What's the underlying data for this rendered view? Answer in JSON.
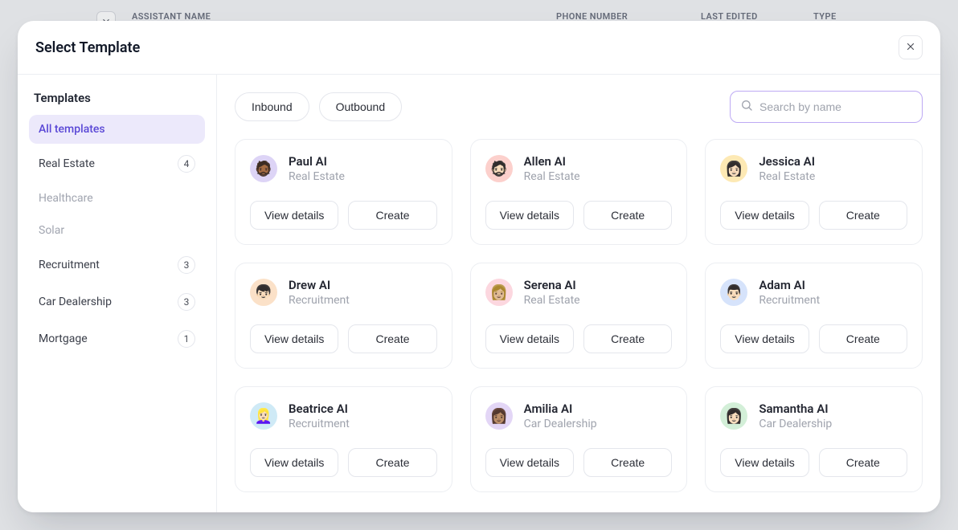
{
  "background": {
    "columns": {
      "assistant": "ASSISTANT NAME",
      "phone": "PHONE NUMBER",
      "edited": "LAST EDITED",
      "type": "TYPE"
    }
  },
  "modal": {
    "title": "Select Template",
    "sidebar": {
      "title": "Templates",
      "items": [
        {
          "label": "All templates",
          "active": true
        },
        {
          "label": "Real Estate",
          "count": "4"
        },
        {
          "label": "Healthcare",
          "muted": true
        },
        {
          "label": "Solar",
          "muted": true
        },
        {
          "label": "Recruitment",
          "count": "3"
        },
        {
          "label": "Car Dealership",
          "count": "3"
        },
        {
          "label": "Mortgage",
          "count": "1"
        }
      ]
    },
    "toolbar": {
      "filters": [
        "Inbound",
        "Outbound"
      ],
      "search_placeholder": "Search by name"
    },
    "card_buttons": {
      "details": "View details",
      "create": "Create"
    },
    "templates": [
      {
        "name": "Paul AI",
        "category": "Real Estate",
        "avatar_bg": "#ddd4f6",
        "emoji": "🧔🏾"
      },
      {
        "name": "Allen AI",
        "category": "Real Estate",
        "avatar_bg": "#fcd0cc",
        "emoji": "🧔🏻"
      },
      {
        "name": "Jessica AI",
        "category": "Real Estate",
        "avatar_bg": "#fde9b4",
        "emoji": "👩🏻"
      },
      {
        "name": "Drew AI",
        "category": "Recruitment",
        "avatar_bg": "#fbe1c8",
        "emoji": "👦🏻"
      },
      {
        "name": "Serena AI",
        "category": "Real Estate",
        "avatar_bg": "#fcd7df",
        "emoji": "👩🏼"
      },
      {
        "name": "Adam AI",
        "category": "Recruitment",
        "avatar_bg": "#d6e3fb",
        "emoji": "👨🏻"
      },
      {
        "name": "Beatrice AI",
        "category": "Recruitment",
        "avatar_bg": "#cfeaf6",
        "emoji": "👱🏻‍♀️"
      },
      {
        "name": "Amilia AI",
        "category": "Car Dealership",
        "avatar_bg": "#e3d6f6",
        "emoji": "👩🏽"
      },
      {
        "name": "Samantha AI",
        "category": "Car Dealership",
        "avatar_bg": "#d3efd8",
        "emoji": "👩🏻"
      }
    ]
  }
}
